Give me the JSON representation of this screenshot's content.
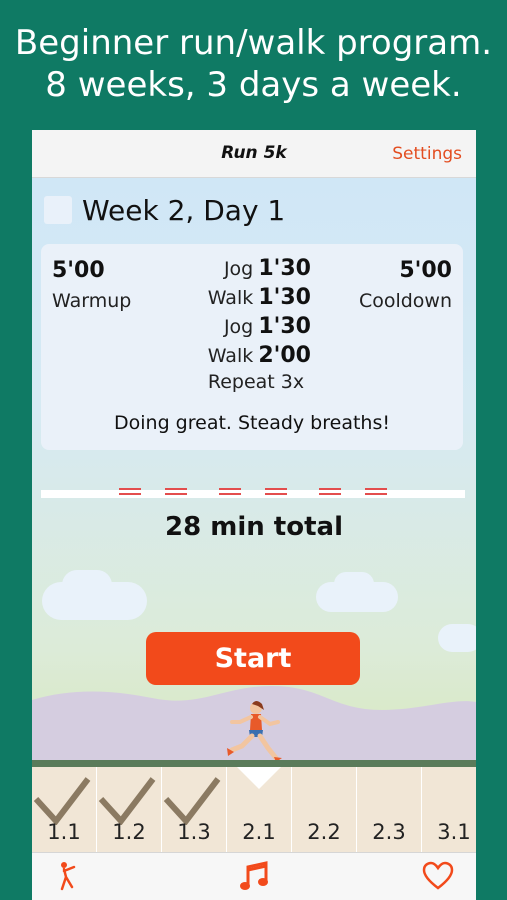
{
  "promo": {
    "line1": "Beginner run/walk program.",
    "line2": "8 weeks, 3 days a week."
  },
  "navbar": {
    "title": "Run 5k",
    "settings_label": "Settings"
  },
  "workout": {
    "day_title": "Week 2, Day 1",
    "warmup": {
      "time": "5'00",
      "label": "Warmup"
    },
    "cooldown": {
      "time": "5'00",
      "label": "Cooldown"
    },
    "intervals": [
      {
        "activity": "Jog",
        "time": "1'30"
      },
      {
        "activity": "Walk",
        "time": "1'30"
      },
      {
        "activity": "Jog",
        "time": "1'30"
      },
      {
        "activity": "Walk",
        "time": "2'00"
      }
    ],
    "repeat": "Repeat 3x",
    "encouragement": "Doing great. Steady breaths!"
  },
  "total": "28 min total",
  "start_label": "Start",
  "weeks": [
    {
      "label": "1.1",
      "completed": true
    },
    {
      "label": "1.2",
      "completed": true
    },
    {
      "label": "1.3",
      "completed": true
    },
    {
      "label": "2.1",
      "completed": false,
      "current": true
    },
    {
      "label": "2.2",
      "completed": false
    },
    {
      "label": "2.3",
      "completed": false
    },
    {
      "label": "3.1",
      "completed": false
    }
  ],
  "tabs": [
    {
      "icon": "stretch-icon"
    },
    {
      "icon": "music-note-icon"
    },
    {
      "icon": "heart-icon"
    }
  ],
  "colors": {
    "background": "#0f7a64",
    "accent": "#f24a1b",
    "settings": "#e34d20",
    "checkmark": "#8b7a62"
  }
}
